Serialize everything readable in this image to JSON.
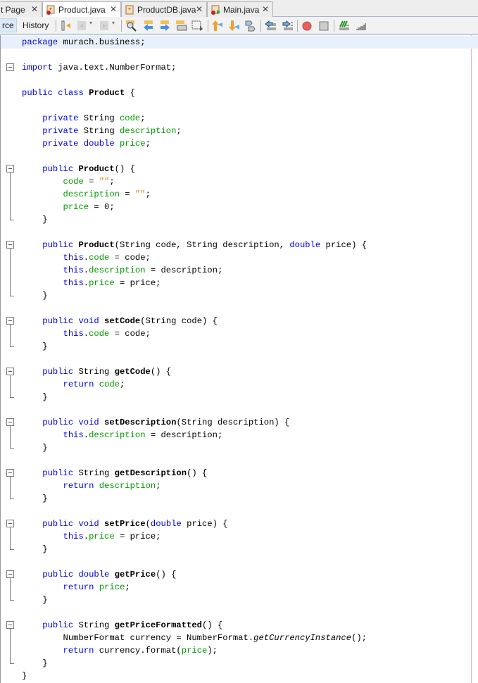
{
  "tabs": [
    {
      "label": "t Page",
      "close": "✕",
      "icon": "start-page-icon"
    },
    {
      "label": "Product.java",
      "close": "✕",
      "icon": "java-file-error-icon",
      "active": true
    },
    {
      "label": "ProductDB.java",
      "close": "✕",
      "icon": "java-file-icon"
    },
    {
      "label": "Main.java",
      "close": "✕",
      "icon": "java-main-file-icon"
    }
  ],
  "toolbar": {
    "source_label": "rce",
    "history_label": "History",
    "icons": [
      "last-edit-icon",
      "back-icon",
      "forward-icon",
      "find-icon",
      "find-previous-icon",
      "find-next-icon",
      "toggle-highlight-icon",
      "toggle-rect-selection-icon",
      "previous-bookmark-icon",
      "next-bookmark-icon",
      "toggle-bookmark-icon",
      "shift-left-icon",
      "shift-right-icon",
      "start-macro-icon",
      "stop-macro-icon",
      "comment-icon",
      "uncomment-icon"
    ]
  },
  "colors": {
    "keyword": "#0000e6",
    "field": "#009900",
    "string": "#ce7b00",
    "current_line": "#e8f0fb",
    "margin": "#f0b0b0"
  },
  "code": [
    [
      {
        "t": "package",
        "c": "kw"
      },
      {
        "t": " murach.business;"
      }
    ],
    [],
    [
      {
        "t": "import",
        "c": "kw"
      },
      {
        "t": " java.text.NumberFormat;"
      }
    ],
    [],
    [
      {
        "t": "public class",
        "c": "kw"
      },
      {
        "t": " "
      },
      {
        "t": "Product",
        "c": "bold"
      },
      {
        "t": " {"
      }
    ],
    [],
    [
      {
        "t": "    private",
        "c": "kw"
      },
      {
        "t": " String "
      },
      {
        "t": "code",
        "c": "fld"
      },
      {
        "t": ";"
      }
    ],
    [
      {
        "t": "    private",
        "c": "kw"
      },
      {
        "t": " String "
      },
      {
        "t": "description",
        "c": "fld"
      },
      {
        "t": ";"
      }
    ],
    [
      {
        "t": "    private double",
        "c": "kw"
      },
      {
        "t": " "
      },
      {
        "t": "price",
        "c": "fld"
      },
      {
        "t": ";"
      }
    ],
    [],
    [
      {
        "t": "    public",
        "c": "kw"
      },
      {
        "t": " "
      },
      {
        "t": "Product",
        "c": "bold"
      },
      {
        "t": "() {"
      }
    ],
    [
      {
        "t": "        "
      },
      {
        "t": "code",
        "c": "fld"
      },
      {
        "t": " = "
      },
      {
        "t": "\"\"",
        "c": "str"
      },
      {
        "t": ";"
      }
    ],
    [
      {
        "t": "        "
      },
      {
        "t": "description",
        "c": "fld"
      },
      {
        "t": " = "
      },
      {
        "t": "\"\"",
        "c": "str"
      },
      {
        "t": ";"
      }
    ],
    [
      {
        "t": "        "
      },
      {
        "t": "price",
        "c": "fld"
      },
      {
        "t": " = 0;"
      }
    ],
    [
      {
        "t": "    }"
      }
    ],
    [],
    [
      {
        "t": "    public",
        "c": "kw"
      },
      {
        "t": " "
      },
      {
        "t": "Product",
        "c": "bold"
      },
      {
        "t": "(String code, String description, "
      },
      {
        "t": "double",
        "c": "kw"
      },
      {
        "t": " price) {"
      }
    ],
    [
      {
        "t": "        this",
        "c": "kw"
      },
      {
        "t": "."
      },
      {
        "t": "code",
        "c": "fld"
      },
      {
        "t": " = code;"
      }
    ],
    [
      {
        "t": "        this",
        "c": "kw"
      },
      {
        "t": "."
      },
      {
        "t": "description",
        "c": "fld"
      },
      {
        "t": " = description;"
      }
    ],
    [
      {
        "t": "        this",
        "c": "kw"
      },
      {
        "t": "."
      },
      {
        "t": "price",
        "c": "fld"
      },
      {
        "t": " = price;"
      }
    ],
    [
      {
        "t": "    }"
      }
    ],
    [],
    [
      {
        "t": "    public void",
        "c": "kw"
      },
      {
        "t": " "
      },
      {
        "t": "setCode",
        "c": "bold"
      },
      {
        "t": "(String code) {"
      }
    ],
    [
      {
        "t": "        this",
        "c": "kw"
      },
      {
        "t": "."
      },
      {
        "t": "code",
        "c": "fld"
      },
      {
        "t": " = code;"
      }
    ],
    [
      {
        "t": "    }"
      }
    ],
    [],
    [
      {
        "t": "    public",
        "c": "kw"
      },
      {
        "t": " String "
      },
      {
        "t": "getCode",
        "c": "bold"
      },
      {
        "t": "() {"
      }
    ],
    [
      {
        "t": "        return",
        "c": "kw"
      },
      {
        "t": " "
      },
      {
        "t": "code",
        "c": "fld"
      },
      {
        "t": ";"
      }
    ],
    [
      {
        "t": "    }"
      }
    ],
    [],
    [
      {
        "t": "    public void",
        "c": "kw"
      },
      {
        "t": " "
      },
      {
        "t": "setDescription",
        "c": "bold"
      },
      {
        "t": "(String description) {"
      }
    ],
    [
      {
        "t": "        this",
        "c": "kw"
      },
      {
        "t": "."
      },
      {
        "t": "description",
        "c": "fld"
      },
      {
        "t": " = description;"
      }
    ],
    [
      {
        "t": "    }"
      }
    ],
    [],
    [
      {
        "t": "    public",
        "c": "kw"
      },
      {
        "t": " String "
      },
      {
        "t": "getDescription",
        "c": "bold"
      },
      {
        "t": "() {"
      }
    ],
    [
      {
        "t": "        return",
        "c": "kw"
      },
      {
        "t": " "
      },
      {
        "t": "description",
        "c": "fld"
      },
      {
        "t": ";"
      }
    ],
    [
      {
        "t": "    }"
      }
    ],
    [],
    [
      {
        "t": "    public void",
        "c": "kw"
      },
      {
        "t": " "
      },
      {
        "t": "setPrice",
        "c": "bold"
      },
      {
        "t": "("
      },
      {
        "t": "double",
        "c": "kw"
      },
      {
        "t": " price) {"
      }
    ],
    [
      {
        "t": "        this",
        "c": "kw"
      },
      {
        "t": "."
      },
      {
        "t": "price",
        "c": "fld"
      },
      {
        "t": " = price;"
      }
    ],
    [
      {
        "t": "    }"
      }
    ],
    [],
    [
      {
        "t": "    public double",
        "c": "kw"
      },
      {
        "t": " "
      },
      {
        "t": "getPrice",
        "c": "bold"
      },
      {
        "t": "() {"
      }
    ],
    [
      {
        "t": "        return",
        "c": "kw"
      },
      {
        "t": " "
      },
      {
        "t": "price",
        "c": "fld"
      },
      {
        "t": ";"
      }
    ],
    [
      {
        "t": "    }"
      }
    ],
    [],
    [
      {
        "t": "    public",
        "c": "kw"
      },
      {
        "t": " String "
      },
      {
        "t": "getPriceFormatted",
        "c": "bold"
      },
      {
        "t": "() {"
      }
    ],
    [
      {
        "t": "        NumberFormat currency = NumberFormat."
      },
      {
        "t": "getCurrencyInstance",
        "c": "it"
      },
      {
        "t": "();"
      }
    ],
    [
      {
        "t": "        return",
        "c": "kw"
      },
      {
        "t": " currency.format("
      },
      {
        "t": "price",
        "c": "fld"
      },
      {
        "t": ");"
      }
    ],
    [
      {
        "t": "    }"
      }
    ],
    [
      {
        "t": "}"
      }
    ]
  ],
  "folds": [
    {
      "start": 2,
      "end": 2
    },
    {
      "start": 10,
      "end": 14
    },
    {
      "start": 16,
      "end": 20
    },
    {
      "start": 22,
      "end": 24
    },
    {
      "start": 26,
      "end": 28
    },
    {
      "start": 30,
      "end": 32
    },
    {
      "start": 34,
      "end": 36
    },
    {
      "start": 38,
      "end": 40
    },
    {
      "start": 42,
      "end": 44
    },
    {
      "start": 46,
      "end": 49
    }
  ]
}
